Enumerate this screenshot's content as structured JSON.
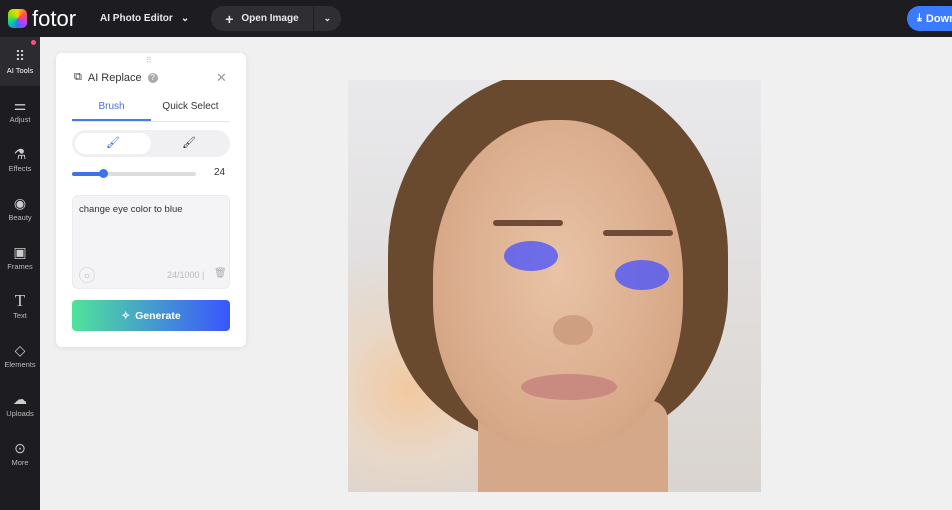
{
  "header": {
    "brand": "fotor",
    "menu_label": "AI Photo Editor",
    "open_image_label": "Open Image",
    "download_label": "Down"
  },
  "sidebar": {
    "items": [
      {
        "label": "AI Tools",
        "icon": "grid-icon",
        "active": true
      },
      {
        "label": "Adjust",
        "icon": "sliders-icon"
      },
      {
        "label": "Effects",
        "icon": "flask-icon"
      },
      {
        "label": "Beauty",
        "icon": "eye-icon"
      },
      {
        "label": "Frames",
        "icon": "frame-icon"
      },
      {
        "label": "Text",
        "icon": "text-icon"
      },
      {
        "label": "Elements",
        "icon": "shapes-icon"
      },
      {
        "label": "Uploads",
        "icon": "cloud-upload-icon"
      },
      {
        "label": "More",
        "icon": "more-icon"
      }
    ]
  },
  "panel": {
    "title": "AI Replace",
    "help": "?",
    "tabs": [
      {
        "label": "Brush",
        "active": true
      },
      {
        "label": "Quick Select"
      }
    ],
    "brush_size": 24,
    "brush_size_label": "24",
    "prompt": "change eye color to blue",
    "char_count": "24/1000",
    "generate_label": "Generate"
  },
  "colors": {
    "accent": "#3a7bff",
    "mask": "#4650ff"
  }
}
